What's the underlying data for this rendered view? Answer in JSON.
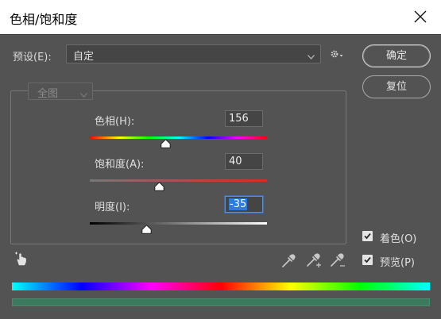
{
  "window": {
    "title": "色相/饱和度"
  },
  "preset": {
    "label": "预设(E):",
    "value": "自定"
  },
  "buttons": {
    "ok": "确定",
    "reset": "复位"
  },
  "channel": {
    "value": "全图"
  },
  "sliders": [
    {
      "label": "色相(H):",
      "value": "156",
      "position_fraction": 0.43
    },
    {
      "label": "饱和度(A):",
      "value": "40",
      "position_fraction": 0.39
    },
    {
      "label": "明度(I):",
      "value": "-35",
      "position_fraction": 0.32
    }
  ],
  "checkboxes": [
    {
      "label": "着色(O)",
      "checked": true
    },
    {
      "label": "预览(P)",
      "checked": true
    }
  ],
  "icons": {
    "close": "close-icon",
    "dropdown": "chevron-down-icon",
    "gear": "gear-icon",
    "hand": "targeted-adjustment-hand-icon",
    "eyedropper": "eyedropper-icon",
    "eyedropper_plus": "eyedropper-plus-icon",
    "eyedropper_minus": "eyedropper-minus-icon"
  },
  "colors": {
    "background": "#535353",
    "result_bar": "#3b7a5c",
    "focus": "#2f7bd9"
  }
}
